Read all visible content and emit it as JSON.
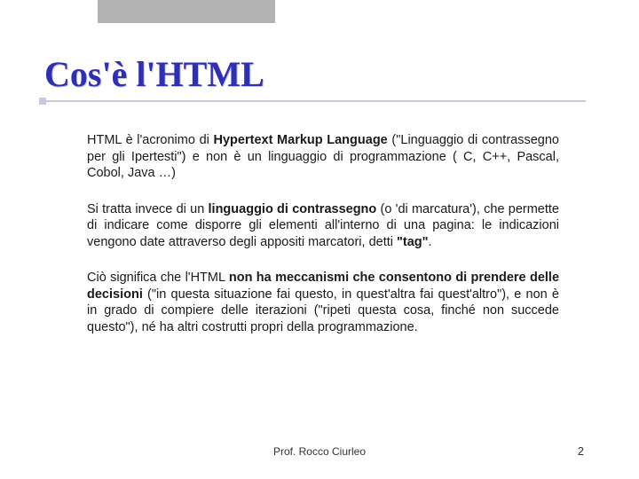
{
  "slide": {
    "title": "Cos'è l'HTML",
    "p1_a": "HTML è l'acronimo di ",
    "p1_b": "Hypertext Markup Language",
    "p1_c": " (\"Linguaggio di contrassegno per gli Ipertesti\") e non è un linguaggio di programmazione ( C,  C++,  Pascal, Cobol, Java …)",
    "p2_a": "Si tratta invece di un ",
    "p2_b": "linguaggio di contrassegno",
    "p2_c": " (o 'di marcatura'), che permette di indicare come disporre gli elementi all'interno di una pagina: le indicazioni vengono date attraverso degli appositi marcatori, detti ",
    "p2_d": "\"tag\"",
    "p2_e": ".",
    "p3_a": "Ciò significa che l'HTML ",
    "p3_b": "non ha meccanismi che consentono di prendere delle decisioni",
    "p3_c": " (\"in questa situazione fai questo, in quest'altra fai quest'altro\"), e non è in grado di compiere delle iterazioni (\"ripeti questa cosa, finché non succede questo\"), né ha altri costrutti propri della programmazione."
  },
  "footer": {
    "author": "Prof. Rocco Ciurleo",
    "page": "2"
  }
}
